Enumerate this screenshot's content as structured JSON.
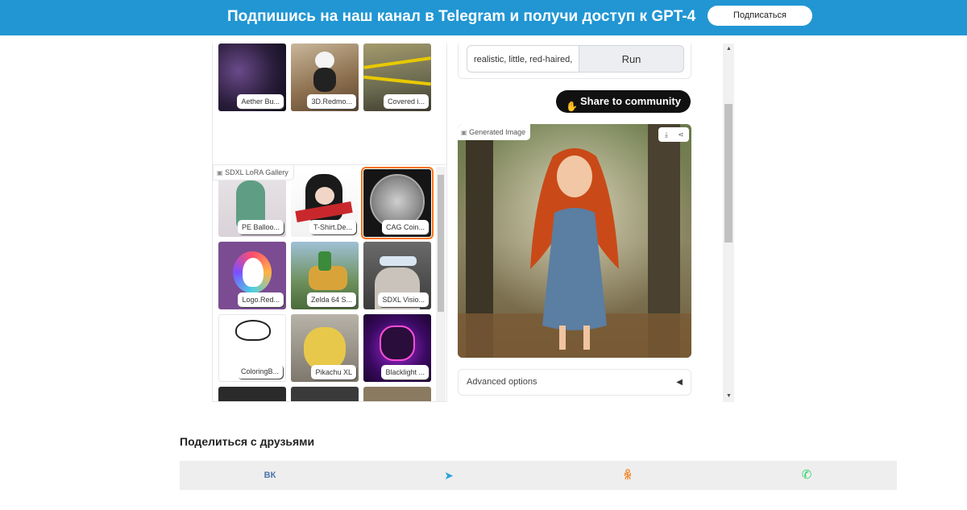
{
  "banner": {
    "text": "Подпишись на наш канал в Telegram и получи доступ к GPT-4",
    "button_label": "Подписаться"
  },
  "gallery": {
    "label": "SDXL LoRA Gallery",
    "top_row": [
      {
        "caption": "Aether Bu..."
      },
      {
        "caption": "3D.Redmo..."
      },
      {
        "caption": "Covered i..."
      }
    ],
    "items": [
      {
        "caption": "PE Balloo..."
      },
      {
        "caption": "T-Shirt.De..."
      },
      {
        "caption": "CAG Coin...",
        "selected": true
      },
      {
        "caption": "Logo.Red..."
      },
      {
        "caption": "Zelda 64 S..."
      },
      {
        "caption": "SDXL Visio..."
      },
      {
        "caption": "ColoringB..."
      },
      {
        "caption": "Pikachu XL"
      },
      {
        "caption": "Blacklight ..."
      }
    ]
  },
  "prompt": {
    "value": "realistic, little, red-haired,",
    "run_label": "Run"
  },
  "share": {
    "label": "Share to community"
  },
  "generated": {
    "label": "Generated Image"
  },
  "advanced": {
    "label": "Advanced options"
  },
  "footer": {
    "title": "Поделиться с друзьями",
    "socials": [
      {
        "name": "vk",
        "glyph": "ВК",
        "color": "#4a76a8"
      },
      {
        "name": "telegram",
        "glyph": "➤",
        "color": "#2aa3dc"
      },
      {
        "name": "odnoklassniki",
        "glyph": "ꆜ",
        "color": "#f58220"
      },
      {
        "name": "whatsapp",
        "glyph": "✆",
        "color": "#25d366"
      }
    ]
  },
  "colors": {
    "banner": "#2196d3",
    "selection": "#f97316",
    "share_button": "#111111"
  }
}
